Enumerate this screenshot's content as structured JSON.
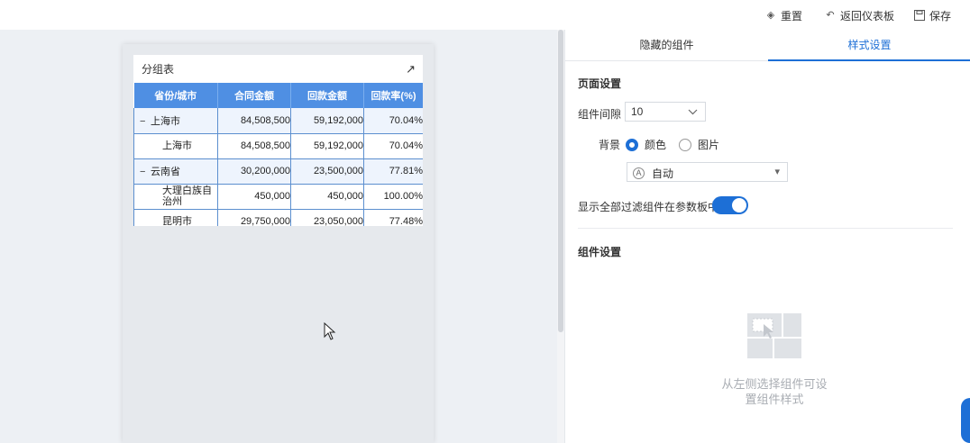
{
  "toolbar": {
    "reset_label": "重置",
    "back_label": "返回仪表板",
    "save_label": "保存"
  },
  "widget": {
    "title": "分组表",
    "columns": [
      "省份/城市",
      "合同金额",
      "回款金额",
      "回款率(%)"
    ],
    "rows": [
      {
        "type": "group",
        "name": "上海市",
        "contract": "84,508,500",
        "payment": "59,192,000",
        "rate": "70.04%"
      },
      {
        "type": "child",
        "name": "上海市",
        "contract": "84,508,500",
        "payment": "59,192,000",
        "rate": "70.04%"
      },
      {
        "type": "group",
        "name": "云南省",
        "contract": "30,200,000",
        "payment": "23,500,000",
        "rate": "77.81%"
      },
      {
        "type": "child",
        "name": "大理白族自治州",
        "contract": "450,000",
        "payment": "450,000",
        "rate": "100.00%"
      },
      {
        "type": "child",
        "name": "昆明市",
        "contract": "29,750,000",
        "payment": "23,050,000",
        "rate": "77.48%"
      }
    ]
  },
  "panel": {
    "tabs": [
      "隐藏的组件",
      "样式设置"
    ],
    "active_tab": "样式设置",
    "page_settings_title": "页面设置",
    "spacing_label": "组件间隙",
    "spacing_value": "10",
    "background_label": "背景",
    "bg_options": [
      "颜色",
      "图片"
    ],
    "bg_selected": "颜色",
    "color_value": "自动",
    "color_mode_icon": "A",
    "show_filters_label": "显示全部过滤组件在参数板中",
    "show_filters_on": true,
    "component_settings_title": "组件设置",
    "empty_hint_line1": "从左侧选择组件可设",
    "empty_hint_line2": "置组件样式"
  },
  "colors": {
    "accent": "#1d6fd6",
    "header": "#4f8fe3"
  }
}
